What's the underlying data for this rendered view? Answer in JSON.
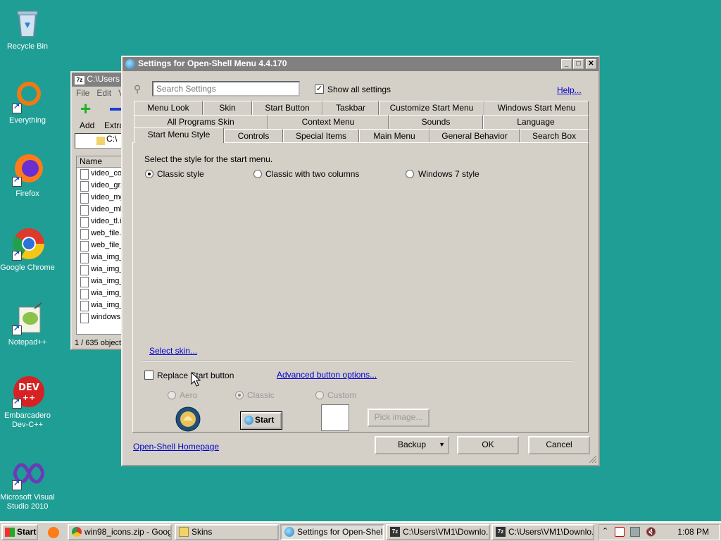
{
  "desktop_icons": [
    {
      "label": "Recycle Bin",
      "icon": "recycle-bin-icon"
    },
    {
      "label": "Everything",
      "icon": "everything-icon"
    },
    {
      "label": "Firefox",
      "icon": "firefox-icon"
    },
    {
      "label": "Google Chrome",
      "icon": "chrome-icon"
    },
    {
      "label": "Notepad++",
      "icon": "notepadpp-icon"
    },
    {
      "label": "Embarcadero Dev-C++",
      "icon": "devcpp-icon"
    },
    {
      "label": "Microsoft Visual Studio 2010",
      "icon": "visual-studio-icon"
    }
  ],
  "bg_window": {
    "title": "C:\\Users",
    "menu": [
      "File",
      "Edit",
      "V"
    ],
    "tools": [
      "Add",
      "Extra"
    ],
    "address": "C:\\",
    "column": "Name",
    "files": [
      "video_co",
      "video_gr.",
      "video_mg",
      "video_mk",
      "video_tl.i",
      "web_file.i",
      "web_file_",
      "wia_img_",
      "wia_img_",
      "wia_img_",
      "wia_img_",
      "wia_img_",
      "windows."
    ],
    "status": "1 / 635 object"
  },
  "dialog": {
    "title": "Settings for Open-Shell Menu 4.4.170",
    "search_placeholder": "Search Settings",
    "show_all": "Show all settings",
    "help": "Help...",
    "tabs_row1": [
      "Menu Look",
      "Skin",
      "Start Button",
      "Taskbar",
      "Customize Start Menu",
      "Windows Start Menu"
    ],
    "tabs_row2": [
      "All Programs Skin",
      "Context Menu",
      "Sounds",
      "Language"
    ],
    "tabs_row3": [
      "Start Menu Style",
      "Controls",
      "Special Items",
      "Main Menu",
      "General Behavior",
      "Search Box"
    ],
    "style_prompt": "Select the style for the start menu.",
    "styles": [
      "Classic style",
      "Classic with two columns",
      "Windows 7 style"
    ],
    "select_skin": "Select skin...",
    "replace_start": "Replace Start button",
    "advanced_options": "Advanced button options...",
    "button_styles": [
      "Aero",
      "Classic",
      "Custom"
    ],
    "start_preview": "Start",
    "pick_image": "Pick image...",
    "homepage": "Open-Shell Homepage",
    "backup": "Backup",
    "ok": "OK",
    "cancel": "Cancel"
  },
  "taskbar": {
    "start": "Start",
    "items": [
      "win98_icons.zip - Googl...",
      "Skins",
      "Settings for Open-Shell ...",
      "C:\\Users\\VM1\\Downlo...",
      "C:\\Users\\VM1\\Downlo..."
    ],
    "clock": "1:08 PM"
  }
}
